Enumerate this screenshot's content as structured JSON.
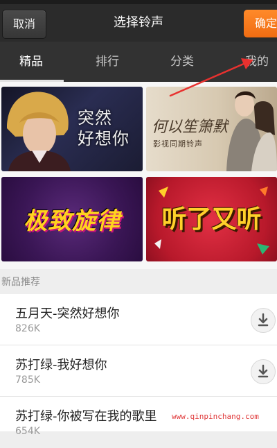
{
  "titlebar": {
    "cancel_label": "取消",
    "title": "选择铃声",
    "confirm_label": "确定"
  },
  "tabs": [
    {
      "label": "精品",
      "active": true
    },
    {
      "label": "排行",
      "active": false
    },
    {
      "label": "分类",
      "active": false
    },
    {
      "label": "我的",
      "active": false
    }
  ],
  "banners": [
    {
      "text": "突然\n好想你"
    },
    {
      "text": "何以笙箫默",
      "sub": "影视同期铃声"
    },
    {
      "text": "极致旋律"
    },
    {
      "text": "听了又听"
    }
  ],
  "section": {
    "label": "新品推荐"
  },
  "items": [
    {
      "title": "五月天-突然好想你",
      "size": "826K"
    },
    {
      "title": "苏打绿-我好想你",
      "size": "785K"
    },
    {
      "title": "苏打绿-你被写在我的歌里",
      "size": "654K"
    }
  ],
  "watermark": "www.qinpinchang.com",
  "colors": {
    "accent": "#f2741a",
    "header_bg": "#2b2b2b",
    "tab_bg": "#323232",
    "annotation_arrow": "#e8312f"
  },
  "icons": {
    "download": "download-icon"
  }
}
